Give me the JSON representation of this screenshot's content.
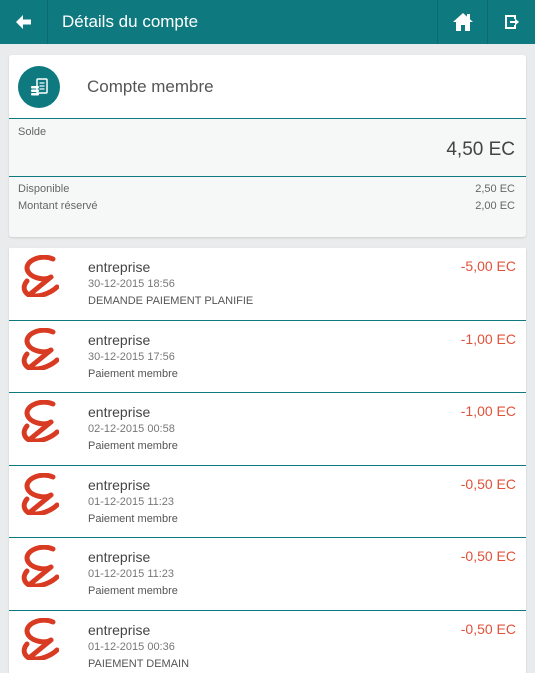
{
  "header": {
    "title": "Détails du compte",
    "back_icon": "arrow-left-icon",
    "home_icon": "home-icon",
    "exit_icon": "logout-icon"
  },
  "account": {
    "icon": "wallet-icon",
    "name": "Compte membre",
    "solde_label": "Solde",
    "solde_value": "4,50 EC",
    "available_label": "Disponible",
    "available_value": "2,50 EC",
    "reserved_label": "Montant réservé",
    "reserved_value": "2,00 EC"
  },
  "transactions": [
    {
      "name": "entreprise",
      "date": "30-12-2015 18:56",
      "description": "DEMANDE PAIEMENT PLANIFIE",
      "amount": "-5,00 EC"
    },
    {
      "name": "entreprise",
      "date": "30-12-2015 17:56",
      "description": "Paiement membre",
      "amount": "-1,00 EC"
    },
    {
      "name": "entreprise",
      "date": "02-12-2015 00:58",
      "description": "Paiement membre",
      "amount": "-1,00 EC"
    },
    {
      "name": "entreprise",
      "date": "01-12-2015 11:23",
      "description": "Paiement membre",
      "amount": "-0,50 EC"
    },
    {
      "name": "entreprise",
      "date": "01-12-2015 11:23",
      "description": "Paiement membre",
      "amount": "-0,50 EC"
    },
    {
      "name": "entreprise",
      "date": "01-12-2015 00:36",
      "description": "PAIEMENT DEMAIN",
      "amount": "-0,50 EC"
    }
  ],
  "colors": {
    "primary": "#0e7a80",
    "negative_amount": "#e0523a",
    "logo": "#d83a22",
    "background": "#e9ebec"
  }
}
